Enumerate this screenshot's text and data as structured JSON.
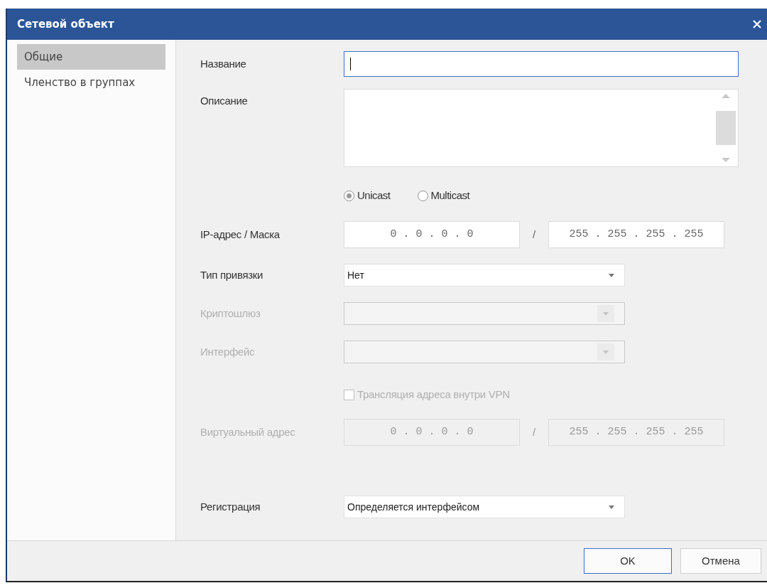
{
  "window": {
    "title": "Сетевой объект"
  },
  "sidebar": {
    "items": [
      {
        "label": "Общие",
        "selected": true
      },
      {
        "label": "Членство в группах",
        "selected": false
      }
    ]
  },
  "form": {
    "sections": [
      [
        {
          "kind": "text",
          "label": "Название",
          "focused": true
        },
        {
          "kind": "textarea",
          "label": "Описание"
        },
        {
          "kind": "radios",
          "options": [
            {
              "label": "Unicast",
              "selected": true
            },
            {
              "label": "Multicast",
              "selected": false
            }
          ]
        },
        {
          "kind": "ip",
          "label": "IP-адрес / Маска",
          "address": "0 . 0 . 0 . 0",
          "separator": "/",
          "mask": "255 . 255 . 255 . 255",
          "disabled": false
        },
        {
          "kind": "select",
          "label": "Тип привязки",
          "value": "Нет",
          "disabled": false
        },
        {
          "kind": "select",
          "label": "Криптошлюз",
          "disabled": true
        },
        {
          "kind": "select",
          "label": "Интерфейс",
          "disabled": true
        },
        {
          "kind": "checkbox",
          "label": "Трансляция адреса внутри VPN",
          "checked": false,
          "disabled": true
        },
        {
          "kind": "ip",
          "label": "Виртуальный адрес",
          "address": "0 . 0 . 0 . 0",
          "separator": "/",
          "mask": "255 . 255 . 255 . 255",
          "disabled": true
        }
      ],
      [
        {
          "kind": "select",
          "label": "Регистрация",
          "value": "Определяется интерфейсом",
          "disabled": false
        }
      ]
    ]
  },
  "buttons": [
    {
      "label": "OK",
      "default": true
    },
    {
      "label": "Отмена",
      "default": false
    }
  ]
}
